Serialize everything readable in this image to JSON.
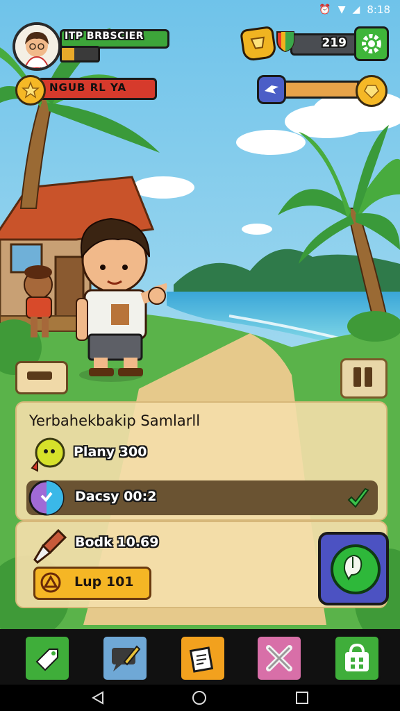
{
  "status_bar": {
    "time": "8:18"
  },
  "player": {
    "name": "ITP BRBSCIER",
    "xp_progress": 0.35
  },
  "banner": {
    "title": "NGUB RL YA"
  },
  "resources": {
    "gems": "219",
    "energy_progress": 0.92
  },
  "panel": {
    "title": "Yerbahekbakip Samlarll",
    "rows": [
      {
        "label": "Plany 300",
        "icon": "smiley-icon"
      },
      {
        "label": "Dacsy 00:2",
        "icon": "clock-icon",
        "status_icon": "check-icon"
      }
    ],
    "book_label": "Bodk 10.69",
    "upgrade_label": "Lup 101"
  },
  "nav": {
    "items": [
      {
        "name": "tag-icon",
        "color": "#3fae3a"
      },
      {
        "name": "chat-pencil-icon",
        "color": "#6fa8d6"
      },
      {
        "name": "cards-icon",
        "color": "#f2a11e"
      },
      {
        "name": "close-x-icon",
        "color": "#d86fa8"
      },
      {
        "name": "shop-bag-icon",
        "color": "#3fae3a"
      }
    ]
  },
  "colors": {
    "accent_green": "#3fb53a",
    "banner_red": "#d63a2c",
    "gold": "#f5b826"
  }
}
